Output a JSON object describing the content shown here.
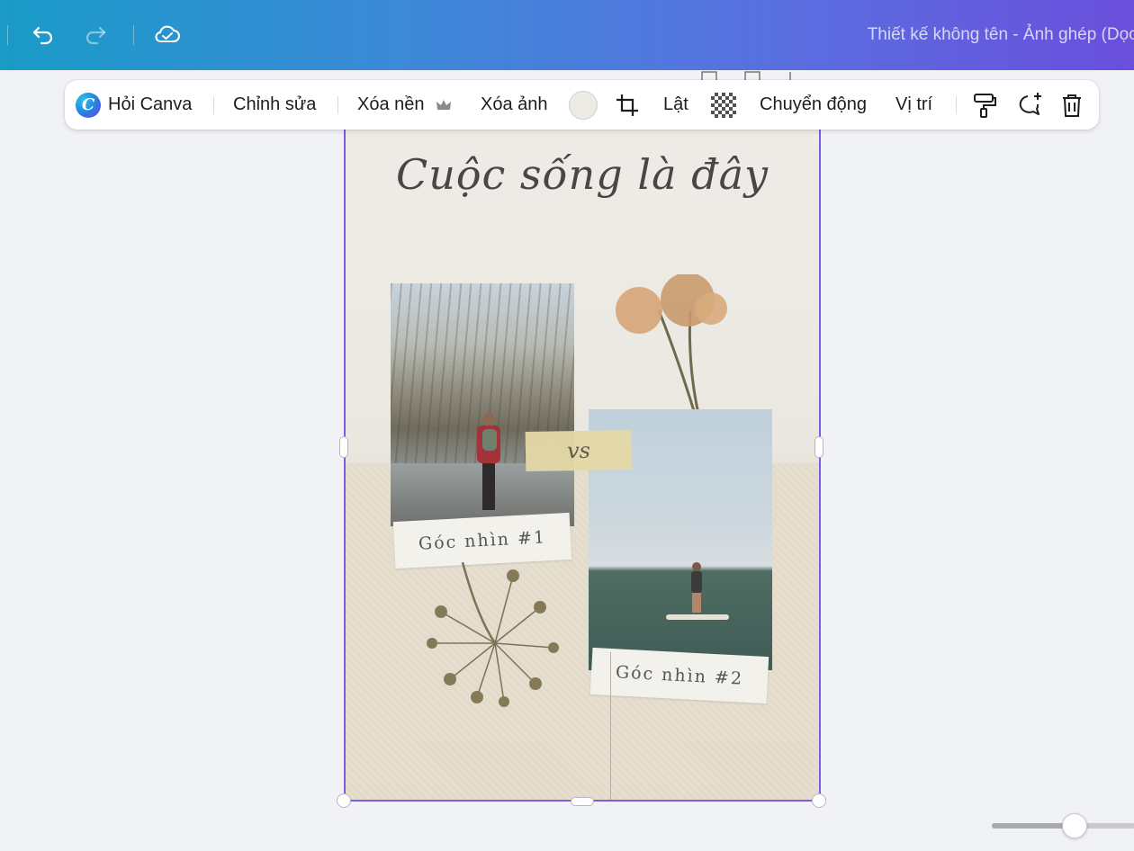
{
  "header": {
    "document_title": "Thiết kế không tên - Ảnh ghép (Dọc)",
    "undo_icon": "undo-icon",
    "redo_icon": "redo-icon",
    "cloud_icon": "cloud-check-icon"
  },
  "toolbar": {
    "ask_canva": "Hỏi Canva",
    "edit": "Chỉnh sửa",
    "remove_bg": "Xóa nền",
    "remove_image": "Xóa ảnh",
    "flip": "Lật",
    "animate": "Chuyển động",
    "position": "Vị trí",
    "swatch_color": "#ecebe6",
    "icons": [
      "canva-logo-icon",
      "crown-icon",
      "crop-icon",
      "transparency-icon",
      "paint-roller-icon",
      "comment-add-icon",
      "trash-icon"
    ]
  },
  "design": {
    "title": "Cuộc sống là đây",
    "label1": "Góc nhìn #1",
    "label2": "Góc nhìn #2",
    "tape_text": "vs"
  },
  "colors": {
    "accent_selection": "#7d5ce0",
    "header_gradient_start": "#1a9bc8",
    "header_gradient_end": "#6a4fdc"
  },
  "zoom": {
    "level_fraction": 0.55
  }
}
